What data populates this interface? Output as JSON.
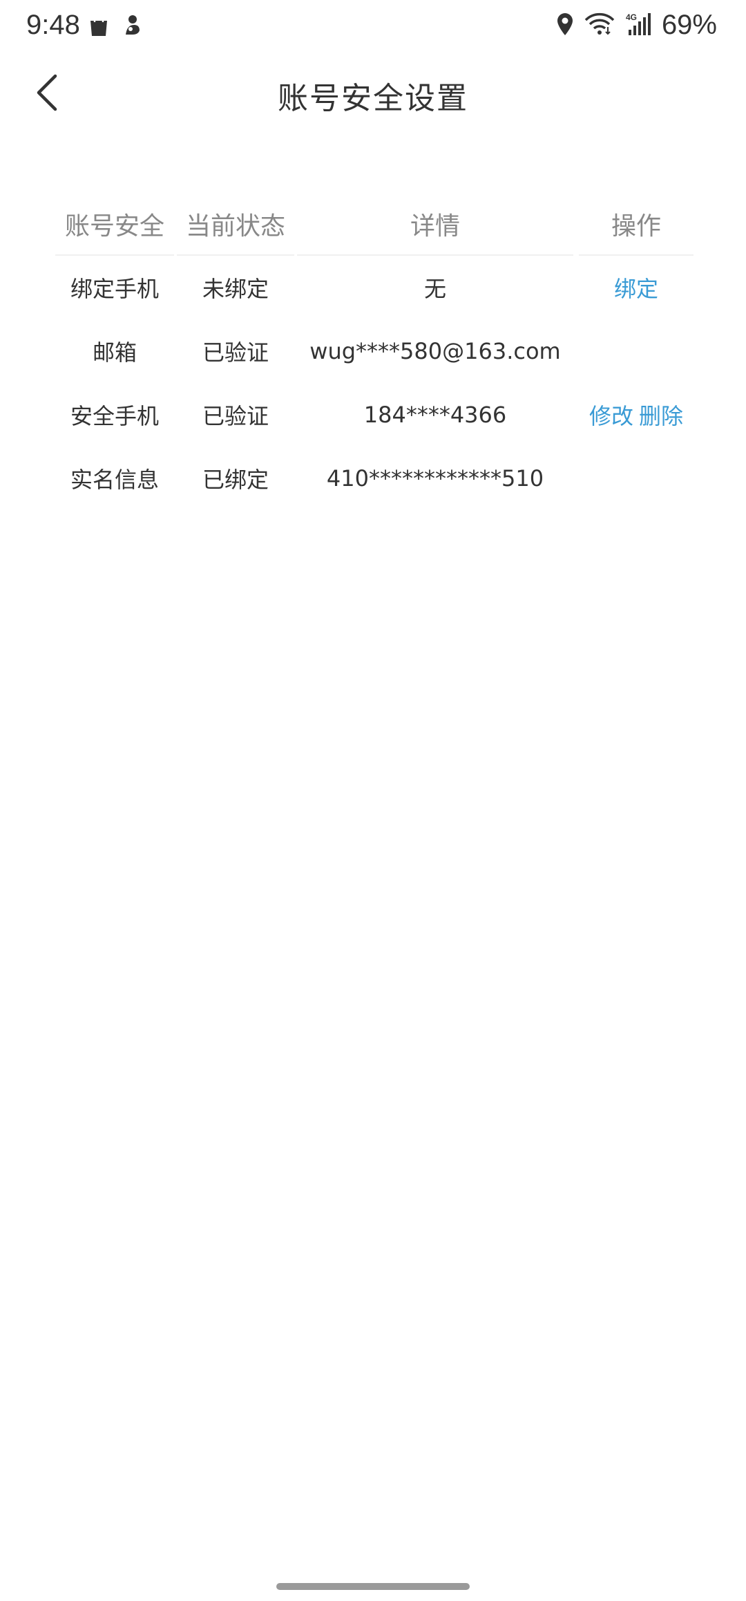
{
  "status_bar": {
    "time": "9:48",
    "battery": "69%",
    "network": "4G"
  },
  "header": {
    "title": "账号安全设置"
  },
  "table": {
    "columns": [
      "账号安全",
      "当前状态",
      "详情",
      "操作"
    ],
    "rows": [
      {
        "item": "绑定手机",
        "status": "未绑定",
        "detail": "无",
        "actions": [
          "绑定"
        ]
      },
      {
        "item": "邮箱",
        "status": "已验证",
        "detail": "wug****580@163.com",
        "actions": []
      },
      {
        "item": "安全手机",
        "status": "已验证",
        "detail": "184****4366",
        "actions": [
          "修改",
          "删除"
        ]
      },
      {
        "item": "实名信息",
        "status": "已绑定",
        "detail": "410************510",
        "actions": []
      }
    ]
  },
  "colors": {
    "accent": "#3a9bd5",
    "text": "#333333",
    "header_text": "#888888"
  }
}
